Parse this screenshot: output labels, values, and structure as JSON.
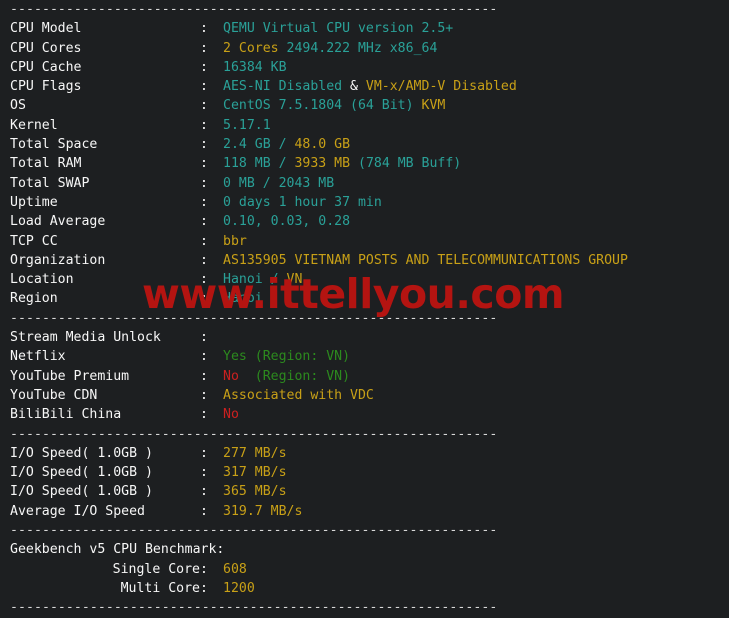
{
  "terminal": {
    "background": "#1d1f21",
    "separator": "-------------------------------------------------------------",
    "colon": ":"
  },
  "colors": {
    "label": "#f7f7f7",
    "cyan": "#2aa198",
    "yellow": "#c8a017",
    "green": "#2c8a1e",
    "red": "#cc2020",
    "watermark": "#b41411"
  },
  "watermark": {
    "text": "www.ittellyou.com"
  },
  "system_info": [
    {
      "label": "CPU Model",
      "parts": [
        {
          "text": "QEMU Virtual CPU version 2.5+",
          "color": "cyan"
        }
      ]
    },
    {
      "label": "CPU Cores",
      "parts": [
        {
          "text": "2 Cores ",
          "color": "yellow"
        },
        {
          "text": "2494.222 MHz x86_64",
          "color": "cyan"
        }
      ]
    },
    {
      "label": "CPU Cache",
      "parts": [
        {
          "text": "16384 KB",
          "color": "cyan"
        }
      ]
    },
    {
      "label": "CPU Flags",
      "parts": [
        {
          "text": "AES-NI Disabled",
          "color": "cyan"
        },
        {
          "text": " & ",
          "color": "white"
        },
        {
          "text": "VM-x/AMD-V Disabled",
          "color": "yellow"
        }
      ]
    },
    {
      "label": "OS",
      "parts": [
        {
          "text": "CentOS 7.5.1804 (64 Bit) ",
          "color": "cyan"
        },
        {
          "text": "KVM",
          "color": "yellow"
        }
      ]
    },
    {
      "label": "Kernel",
      "parts": [
        {
          "text": "5.17.1",
          "color": "cyan"
        }
      ]
    },
    {
      "label": "Total Space",
      "parts": [
        {
          "text": "2.4 GB ",
          "color": "cyan"
        },
        {
          "text": "/ ",
          "color": "cyan"
        },
        {
          "text": "48.0 GB",
          "color": "yellow"
        }
      ]
    },
    {
      "label": "Total RAM",
      "parts": [
        {
          "text": "118 MB ",
          "color": "cyan"
        },
        {
          "text": "/ ",
          "color": "cyan"
        },
        {
          "text": "3933 MB ",
          "color": "yellow"
        },
        {
          "text": "(784 MB Buff)",
          "color": "cyan"
        }
      ]
    },
    {
      "label": "Total SWAP",
      "parts": [
        {
          "text": "0 MB / 2043 MB",
          "color": "cyan"
        }
      ]
    },
    {
      "label": "Uptime",
      "parts": [
        {
          "text": "0 days 1 hour 37 min",
          "color": "cyan"
        }
      ]
    },
    {
      "label": "Load Average",
      "parts": [
        {
          "text": "0.10, 0.03, 0.28",
          "color": "cyan"
        }
      ]
    },
    {
      "label": "TCP CC",
      "parts": [
        {
          "text": "bbr",
          "color": "yellow"
        }
      ]
    },
    {
      "label": "Organization",
      "parts": [
        {
          "text": "AS135905 VIETNAM POSTS AND TELECOMMUNICATIONS GROUP",
          "color": "yellow"
        }
      ]
    },
    {
      "label": "Location",
      "parts": [
        {
          "text": "Hanoi ",
          "color": "cyan"
        },
        {
          "text": "/ ",
          "color": "cyan"
        },
        {
          "text": "VN",
          "color": "yellow"
        }
      ]
    },
    {
      "label": "Region",
      "parts": [
        {
          "text": "Hanoi",
          "color": "cyan"
        }
      ]
    }
  ],
  "stream_media": {
    "title_label": "Stream Media Unlock",
    "title_value": "",
    "rows": [
      {
        "label": "Netflix",
        "parts": [
          {
            "text": "Yes ",
            "color": "green"
          },
          {
            "text": "(Region: VN)",
            "color": "green"
          }
        ]
      },
      {
        "label": "YouTube Premium",
        "parts": [
          {
            "text": "No ",
            "color": "red"
          },
          {
            "text": " (Region: VN)",
            "color": "green"
          }
        ]
      },
      {
        "label": "YouTube CDN",
        "parts": [
          {
            "text": "Associated with VDC",
            "color": "yellow"
          }
        ]
      },
      {
        "label": "BiliBili China",
        "parts": [
          {
            "text": "No",
            "color": "red"
          }
        ]
      }
    ]
  },
  "io_speed": [
    {
      "label": "I/O Speed( 1.0GB )",
      "parts": [
        {
          "text": "277 MB/s",
          "color": "yellow"
        }
      ]
    },
    {
      "label": "I/O Speed( 1.0GB )",
      "parts": [
        {
          "text": "317 MB/s",
          "color": "yellow"
        }
      ]
    },
    {
      "label": "I/O Speed( 1.0GB )",
      "parts": [
        {
          "text": "365 MB/s",
          "color": "yellow"
        }
      ]
    },
    {
      "label": "Average I/O Speed",
      "parts": [
        {
          "text": "319.7 MB/s",
          "color": "yellow"
        }
      ]
    }
  ],
  "geekbench": {
    "title": "Geekbench v5 CPU Benchmark:",
    "rows": [
      {
        "label": "Single Core",
        "parts": [
          {
            "text": "608",
            "color": "yellow"
          }
        ]
      },
      {
        "label": "Multi Core",
        "parts": [
          {
            "text": "1200",
            "color": "yellow"
          }
        ]
      }
    ]
  }
}
